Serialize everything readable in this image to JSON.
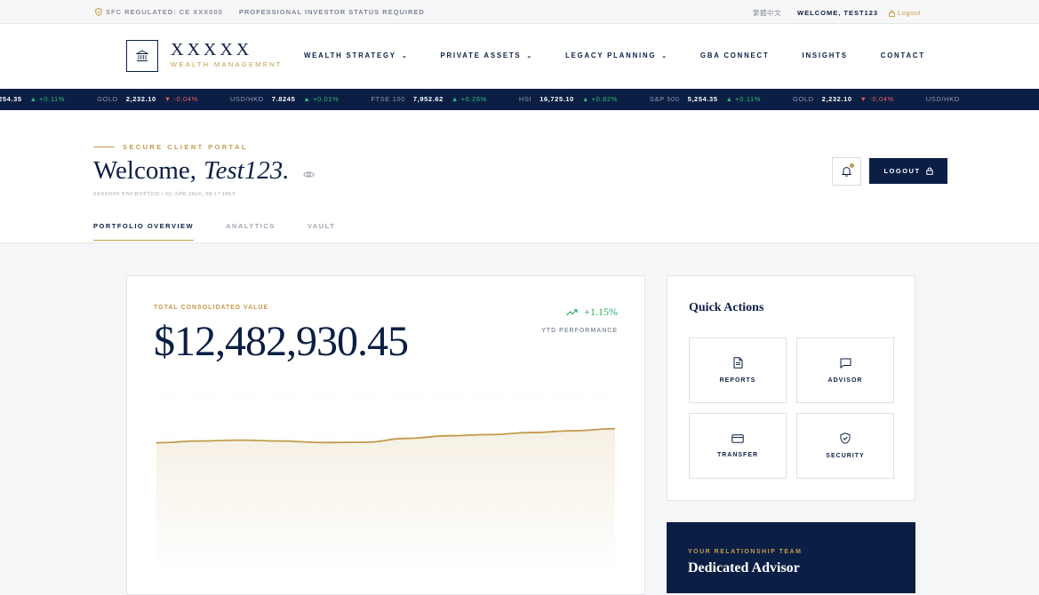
{
  "topbar": {
    "regulation": "SFC REGULATED: CE XXX000",
    "investor_status": "PROFESSIONAL INVESTOR STATUS REQUIRED",
    "language": "繁體中文",
    "welcome": "WELCOME, TEST123",
    "logout": "Logout"
  },
  "brand": {
    "name": "XXXXX",
    "tagline": "WEALTH MANAGEMENT"
  },
  "nav": {
    "items": [
      {
        "label": "WEALTH STRATEGY",
        "dropdown": true
      },
      {
        "label": "PRIVATE ASSETS",
        "dropdown": true
      },
      {
        "label": "LEGACY PLANNING",
        "dropdown": true
      },
      {
        "label": "GBA CONNECT",
        "dropdown": false
      },
      {
        "label": "INSIGHTS",
        "dropdown": false
      },
      {
        "label": "CONTACT",
        "dropdown": false
      }
    ]
  },
  "ticker": [
    {
      "symbol": "S&P 500",
      "value": "5,254.35",
      "change": "+0.11%",
      "direction": "up"
    },
    {
      "symbol": "GOLD",
      "value": "2,232.10",
      "change": "-0.04%",
      "direction": "down"
    },
    {
      "symbol": "USD/HKD",
      "value": "7.8245",
      "change": "+0.01%",
      "direction": "up"
    },
    {
      "symbol": "FTSE 100",
      "value": "7,952.62",
      "change": "+0.26%",
      "direction": "up"
    },
    {
      "symbol": "HSI",
      "value": "16,725.10",
      "change": "+0.82%",
      "direction": "up"
    },
    {
      "symbol": "S&P 500",
      "value": "5,254.35",
      "change": "+0.11%",
      "direction": "up"
    },
    {
      "symbol": "GOLD",
      "value": "2,232.10",
      "change": "-0.04%",
      "direction": "down"
    },
    {
      "symbol": "USD/HKD",
      "value": "",
      "change": "",
      "direction": ""
    }
  ],
  "hero": {
    "portal_label": "SECURE CLIENT PORTAL",
    "welcome_prefix": "Welcome,",
    "username": "Test123.",
    "session": "SESSION ENCRYPTED • 02 APR 2026, 08:17 HKT",
    "logout_button": "LOGOUT",
    "tabs": [
      {
        "label": "PORTFOLIO OVERVIEW",
        "active": true
      },
      {
        "label": "ANALYTICS",
        "active": false
      },
      {
        "label": "VAULT",
        "active": false
      }
    ]
  },
  "portfolio": {
    "label": "TOTAL CONSOLIDATED VALUE",
    "value": "$12,482,930.45",
    "performance": "+1.15%",
    "performance_label": "YTD PERFORMANCE",
    "colors": {
      "line": "#c49a4c",
      "fill": "#f6f0e4"
    }
  },
  "quick_actions": {
    "title": "Quick Actions",
    "items": [
      {
        "label": "REPORTS",
        "icon": "document-icon"
      },
      {
        "label": "ADVISOR",
        "icon": "chat-icon"
      },
      {
        "label": "TRANSFER",
        "icon": "card-icon"
      },
      {
        "label": "SECURITY",
        "icon": "shield-check-icon"
      }
    ]
  },
  "team": {
    "label": "YOUR RELATIONSHIP TEAM",
    "title": "Dedicated Advisor"
  },
  "chart_data": {
    "type": "area",
    "x": [
      0,
      1,
      2,
      3,
      4,
      5,
      6,
      7,
      8,
      9,
      10,
      11
    ],
    "values": [
      100.0,
      100.6,
      100.9,
      100.6,
      100.1,
      100.2,
      101.5,
      102.4,
      102.8,
      103.5,
      104.1,
      104.8
    ],
    "ylim": [
      60,
      115
    ],
    "grid": true
  }
}
